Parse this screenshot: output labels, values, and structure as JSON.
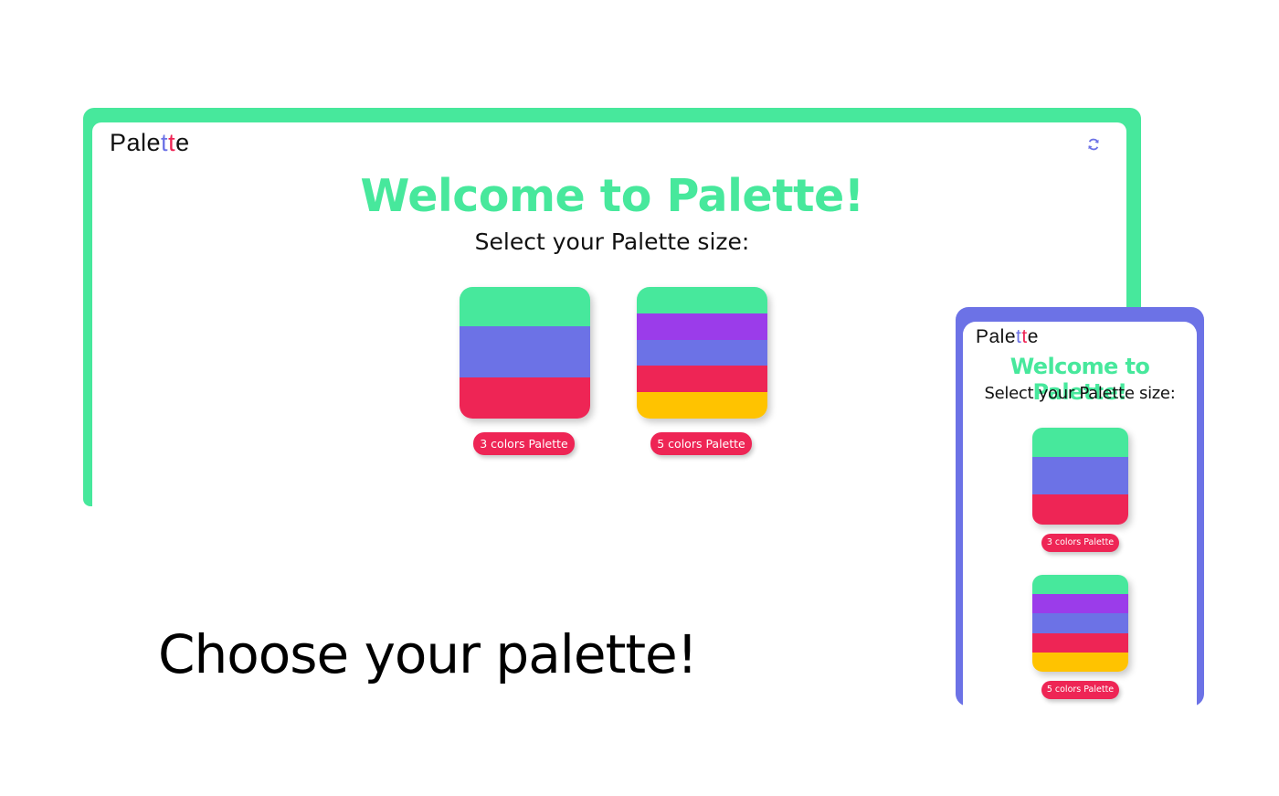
{
  "colors": {
    "green": "#47e89c",
    "blue": "#6c72e6",
    "red": "#ee2555",
    "purple": "#9b3cea",
    "yellow": "#ffc300"
  },
  "desktop": {
    "logo": {
      "pre": "Pale",
      "t1": "t",
      "t2": "t",
      "post": "e"
    },
    "refresh_icon": "refresh-icon",
    "title": "Welcome to Palette!",
    "subtitle": "Select your Palette size:",
    "palettes": [
      {
        "label": "3 colors Palette",
        "stripes": [
          "#47e89c",
          "#6c72e6",
          "#ee2555"
        ]
      },
      {
        "label": "5 colors Palette",
        "stripes": [
          "#47e89c",
          "#9b3cea",
          "#6c72e6",
          "#ee2555",
          "#ffc300"
        ]
      }
    ]
  },
  "mobile": {
    "logo": {
      "pre": "Pale",
      "t1": "t",
      "t2": "t",
      "post": "e"
    },
    "title": "Welcome to Palette!",
    "subtitle": "Select your Palette size:",
    "palettes": [
      {
        "label": "3 colors Palette",
        "stripes": [
          "#47e89c",
          "#6c72e6",
          "#ee2555"
        ]
      },
      {
        "label": "5 colors Palette",
        "stripes": [
          "#47e89c",
          "#9b3cea",
          "#6c72e6",
          "#ee2555",
          "#ffc300"
        ]
      }
    ]
  },
  "caption": "Choose your palette!"
}
